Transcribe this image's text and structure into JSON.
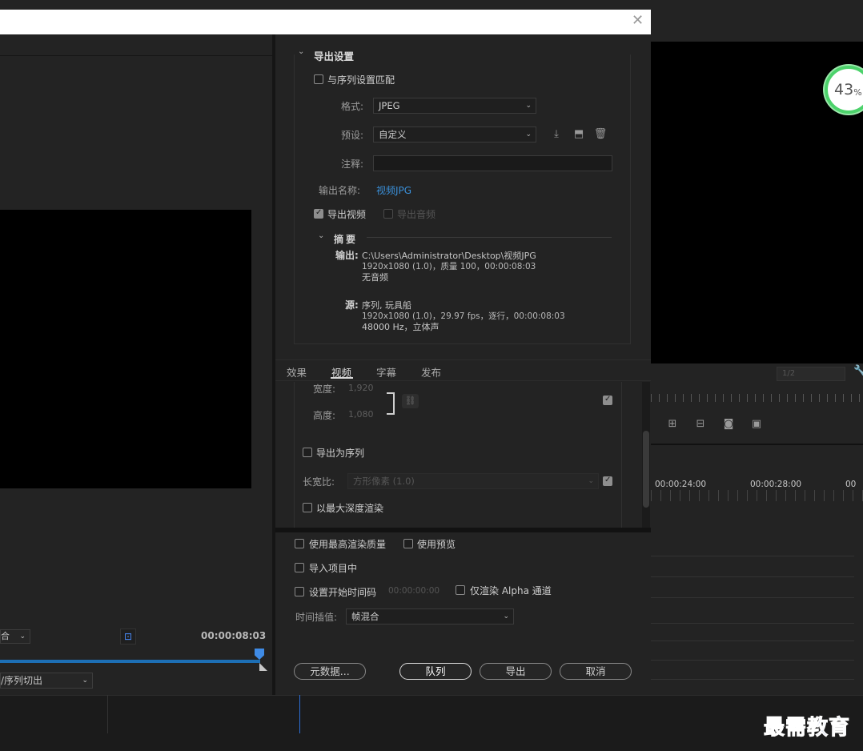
{
  "right_panel": {
    "progress": "43",
    "progress_unit": "%",
    "zoom": "1/2"
  },
  "timeline": {
    "times": [
      "00:00:24:00",
      "00:00:28:00",
      "00"
    ]
  },
  "source": {
    "fit_select": "合",
    "duration": "00:00:08:03",
    "range_select": "/序列切出"
  },
  "export_settings": {
    "section_title": "导出设置",
    "match_sequence": "与序列设置匹配",
    "format_label": "格式:",
    "format_value": "JPEG",
    "preset_label": "预设:",
    "preset_value": "自定义",
    "comments_label": "注释:",
    "comments_value": "",
    "output_name_label": "输出名称:",
    "output_name_value": "视频JPG",
    "export_video": "导出视频",
    "export_audio": "导出音频",
    "summary": {
      "title": "摘要",
      "output_label": "输出:",
      "output_path": "C:\\Users\\Administrator\\Desktop\\视频JPG",
      "output_line2": "1920x1080 (1.0)，质量 100，00:00:08:03",
      "output_line3": "无音频",
      "source_label": "源:",
      "source_line1": "序列, 玩具船",
      "source_line2": "1920x1080 (1.0)，29.97 fps，逐行，00:00:08:03",
      "source_line3": "48000 Hz，立体声"
    }
  },
  "tabs": [
    "效果",
    "视频",
    "字幕",
    "发布"
  ],
  "video": {
    "width_label": "宽度:",
    "width_value": "1,920",
    "height_label": "高度:",
    "height_value": "1,080",
    "export_as_sequence": "导出为序列",
    "aspect_label": "长宽比:",
    "aspect_value": "方形像素 (1.0)",
    "max_depth": "以最大深度渲染"
  },
  "bottom_options": {
    "max_quality": "使用最高渲染质量",
    "use_previews": "使用预览",
    "import_project": "导入项目中",
    "set_start_tc": "设置开始时间码",
    "start_tc_value": "00:00:00:00",
    "alpha_only": "仅渲染 Alpha 通道",
    "interp_label": "时间插值:",
    "interp_value": "帧混合"
  },
  "buttons": {
    "metadata": "元数据...",
    "queue": "队列",
    "export": "导出",
    "cancel": "取消"
  },
  "watermark": "最需教育"
}
